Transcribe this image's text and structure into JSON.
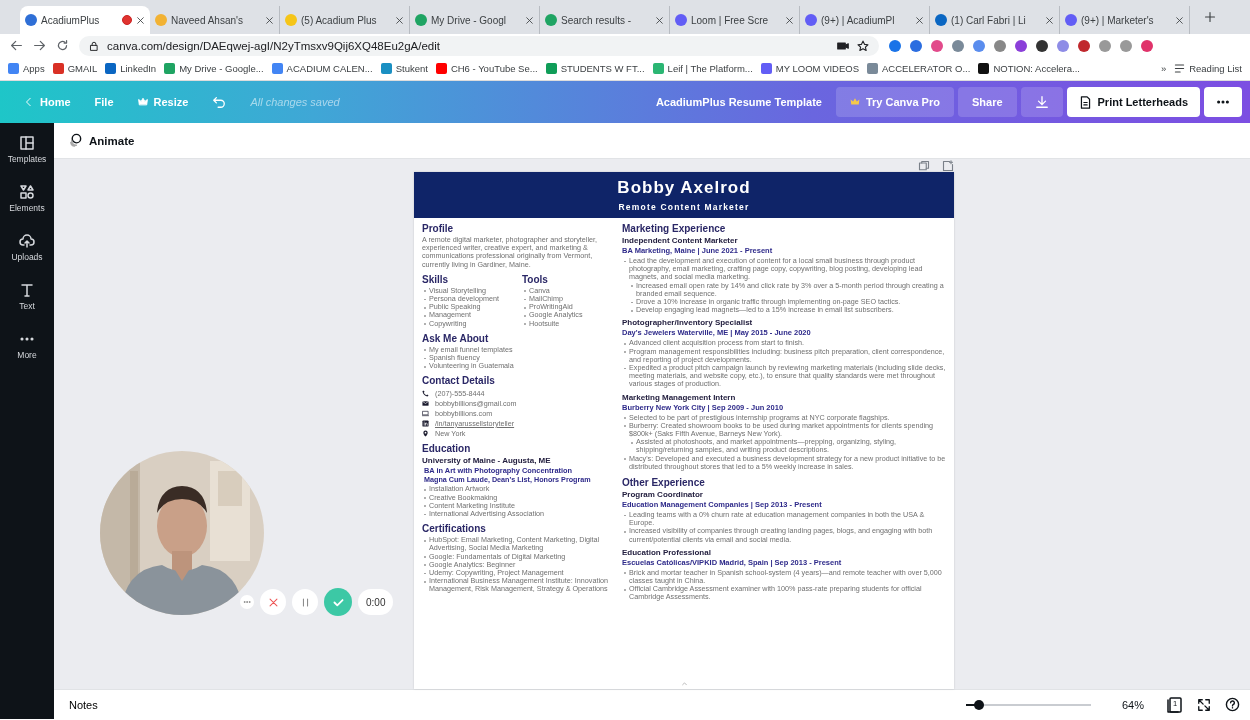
{
  "browser": {
    "tabs": [
      {
        "title": "AcadiumPlus",
        "selected": true,
        "recording": true,
        "color": "#2f6fd6"
      },
      {
        "title": "Naveed Ahsan's",
        "selected": false,
        "recording": false,
        "color": "#f2b233"
      },
      {
        "title": "(5) Acadium Plus",
        "selected": false,
        "recording": false,
        "color": "#f5c518"
      },
      {
        "title": "My Drive - Googl",
        "selected": false,
        "recording": false,
        "color": "#1fa463"
      },
      {
        "title": "Search results - ",
        "selected": false,
        "recording": false,
        "color": "#1fa463"
      },
      {
        "title": "Loom | Free Scre",
        "selected": false,
        "recording": false,
        "color": "#625df5"
      },
      {
        "title": "(9+) | AcadiumPl",
        "selected": false,
        "recording": false,
        "color": "#625df5"
      },
      {
        "title": "(1) Carl Fabri | Li",
        "selected": false,
        "recording": false,
        "color": "#0a66c2"
      },
      {
        "title": "(9+) | Marketer's",
        "selected": false,
        "recording": false,
        "color": "#625df5"
      }
    ],
    "url": "canva.com/design/DAEqwej-agI/N2yTmsxv9Qij6XQ48Eu2gA/edit",
    "bookmarks": [
      {
        "label": "Apps",
        "color": "#4285f4"
      },
      {
        "label": "GMAIL",
        "color": "#d93025"
      },
      {
        "label": "LinkedIn",
        "color": "#0a66c2"
      },
      {
        "label": "My Drive - Google...",
        "color": "#1fa463"
      },
      {
        "label": "ACADIUM CALEN...",
        "color": "#4285f4"
      },
      {
        "label": "Stukent",
        "color": "#1a8fc2"
      },
      {
        "label": "CH6 - YouTube Se...",
        "color": "#ff0000"
      },
      {
        "label": "STUDENTS W FT...",
        "color": "#0f9d58"
      },
      {
        "label": "Leif | The Platform...",
        "color": "#2bb673"
      },
      {
        "label": "MY LOOM VIDEOS",
        "color": "#625df5"
      },
      {
        "label": "ACCELERATOR O...",
        "color": "#7a8a99"
      },
      {
        "label": "NOTION: Accelera...",
        "color": "#111111"
      }
    ],
    "bookmarks_more": "»",
    "reading_list": "Reading List"
  },
  "toolbar": {
    "home": "Home",
    "file": "File",
    "resize": "Resize",
    "save_status": "All changes saved",
    "design_title": "AcadiumPlus Resume Template",
    "try_pro": "Try Canva Pro",
    "share": "Share",
    "print": "Print Letterheads"
  },
  "sidebar": {
    "items": [
      {
        "label": "Templates",
        "kind": "templates"
      },
      {
        "label": "Elements",
        "kind": "elements"
      },
      {
        "label": "Uploads",
        "kind": "uploads"
      },
      {
        "label": "Text",
        "kind": "text"
      },
      {
        "label": "More",
        "kind": "more"
      }
    ]
  },
  "animate": "Animate",
  "resume": {
    "name": "Bobby Axelrod",
    "role": "Remote Content Marketer",
    "profile": {
      "heading": "Profile",
      "text": "A remote digital marketer, photographer and storyteller, experienced writer, creative expert, and marketing & communications professional originally from Vermont, currently living in Gardiner, Maine."
    },
    "skills": {
      "heading": "Skills",
      "items": [
        "Visual Storytelling",
        "Persona development",
        "Public Speaking",
        "Management",
        "Copywriting"
      ]
    },
    "tools": {
      "heading": "Tools",
      "items": [
        "Canva",
        "MailChimp",
        "ProWritingAid",
        "Google Analytics",
        "Hootsuite"
      ]
    },
    "ask": {
      "heading": "Ask Me About",
      "items": [
        "My email funnel templates",
        "Spanish fluency",
        "Volunteering in Guatemala"
      ]
    },
    "contact": {
      "heading": "Contact Details",
      "items": [
        {
          "kind": "phone",
          "text": "(207)-555-8444"
        },
        {
          "kind": "email",
          "text": "bobbybillions@gmail.com"
        },
        {
          "kind": "web",
          "text": "bobbybillions.com"
        },
        {
          "kind": "linkedin",
          "text": "/in/tanyarussellstoryteller"
        },
        {
          "kind": "location",
          "text": "New York"
        }
      ]
    },
    "education": {
      "heading": "Education",
      "school": "University of Maine - Augusta, ME",
      "degree": "BA in Art with Photography Concentration",
      "honors": "Magna Cum Laude, Dean's List, Honors Program",
      "items": [
        "Installation Artwork",
        "Creative Bookmaking",
        "Content Marketing Institute",
        "International Advertising Association"
      ]
    },
    "certifications": {
      "heading": "Certifications",
      "items": [
        "HubSpot: Email Marketing, Content Marketing, Digital Advertising, Social Media Marketing",
        "Google: Fundamentals of Digital Marketing",
        "Google Analytics: Beginner",
        "Udemy: Copywriting, Project Management",
        "International Business Management Institute: Innovation Management, Risk Management, Strategy & Operations"
      ]
    },
    "sections": [
      {
        "heading": "Marketing Experience",
        "jobs": [
          {
            "title": "Independent Content Marketer",
            "company": "BA Marketing, Maine | June 2021 - Present",
            "bullets": [
              {
                "text": "Lead the development and execution of content for a local small business through product photography, email marketing, crafting page copy, copywriting, blog posting, developing lead magnets, and social media marketing.",
                "children": [
                  "Increased email open rate by 14% and click rate by 3% over a 5-month period through creating a branded email sequence.",
                  "Drove a 10% increase in organic traffic through implementing on-page SEO tactics.",
                  "Develop engaging lead magnets—led to a 15% increase in email list subscribers."
                ]
              }
            ]
          },
          {
            "title": "Photographer/Inventory Specialist",
            "company": "Day's Jewelers Waterville, ME | May 2015 - June 2020",
            "bullets": [
              {
                "text": "Advanced client acquisition process from start to finish."
              },
              {
                "text": "Program management responsibilities including: business pitch preparation, client correspondence, and reporting of project developments."
              },
              {
                "text": "Expedited a product pitch campaign launch by reviewing marketing materials (including slide decks, meeting materials, and website copy, etc.), to ensure that quality standards were met throughout various stages of production."
              }
            ]
          },
          {
            "title": "Marketing Management Intern",
            "company": "Burberry New York City  | Sep 2009 - Jun 2010",
            "bullets": [
              {
                "text": "Selected to be part of prestigious internship programs at NYC corporate flagships."
              },
              {
                "text": "Burberry: Created showroom books to be used during market appointments for clients spending $800k+ (Saks Fifth Avenue, Barneys New York).",
                "children": [
                  "Assisted at photoshoots, and market appointments—prepping, organizing, styling, shipping/returning samples, and writing product descriptions."
                ]
              },
              {
                "text": "Macy's: Developed and executed a business development strategy for a new product initiative to be distributed throughout stores that led to a 5% weekly increase in sales."
              }
            ]
          }
        ]
      },
      {
        "heading": "Other Experience",
        "jobs": [
          {
            "title": "Program Coordinator",
            "company": "Education Management Companies  | Sep 2013 - Present",
            "bullets": [
              {
                "text": "Leading teams with a 0% churn rate at education management companies in both the USA & Europe."
              },
              {
                "text": "Increased visibility of companies through creating landing pages, blogs, and engaging with both current/potential clients via email and social media."
              }
            ]
          },
          {
            "title": "Education Professional",
            "company": "Escuelas Católicas/VIPKID Madrid, Spain | Sep 2013 - Present",
            "bullets": [
              {
                "text": "Brick and mortar teacher in Spanish school-system (4 years)—and remote teacher with over 5,000 classes taught in China."
              },
              {
                "text": "Official Cambridge Assessment examiner with 100% pass-rate preparing students for official Cambridge Assessments."
              }
            ]
          }
        ]
      }
    ]
  },
  "recorder": {
    "timer": "0:00"
  },
  "bottom": {
    "notes": "Notes",
    "zoom": {
      "level": 0.1
    },
    "zoom_label": "64%",
    "page_count": "1"
  }
}
